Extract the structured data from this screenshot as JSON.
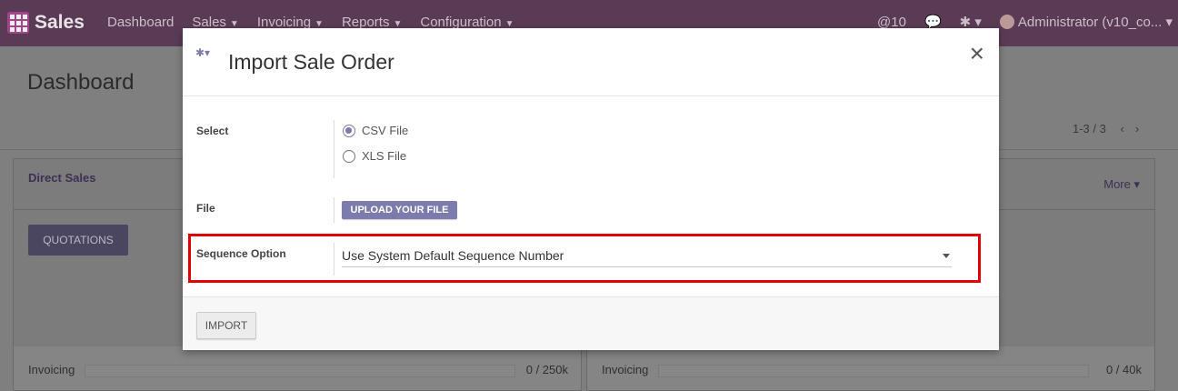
{
  "topbar": {
    "app_name": "Sales",
    "menu": [
      "Dashboard",
      "Sales",
      "Invoicing",
      "Reports",
      "Configuration"
    ],
    "mentions": "@10",
    "user": "Administrator (v10_co..."
  },
  "background": {
    "title": "Dashboard",
    "pager": "1-3 / 3",
    "cards": [
      {
        "title": "Direct Sales",
        "button": "QUOTATIONS",
        "invoicing_label": "Invoicing",
        "invoicing_value": "0 / 250k"
      },
      {
        "more": "More",
        "invoicing_label": "Invoicing",
        "invoicing_value": "0 / 40k"
      }
    ]
  },
  "modal": {
    "title": "Import Sale Order",
    "select_label": "Select",
    "options": [
      "CSV File",
      "XLS File"
    ],
    "selected_option": "CSV File",
    "file_label": "File",
    "upload_label": "UPLOAD YOUR FILE",
    "sequence_label": "Sequence Option",
    "sequence_value": "Use System Default Sequence Number",
    "import_label": "IMPORT"
  },
  "colors": {
    "brand": "#875a7b",
    "accent": "#7c7bad",
    "highlight": "#e20000"
  },
  "icons": [
    "apps-grid-icon",
    "chat-icon",
    "debug-bug-icon",
    "close-icon",
    "chevron-left-icon",
    "chevron-right-icon"
  ]
}
